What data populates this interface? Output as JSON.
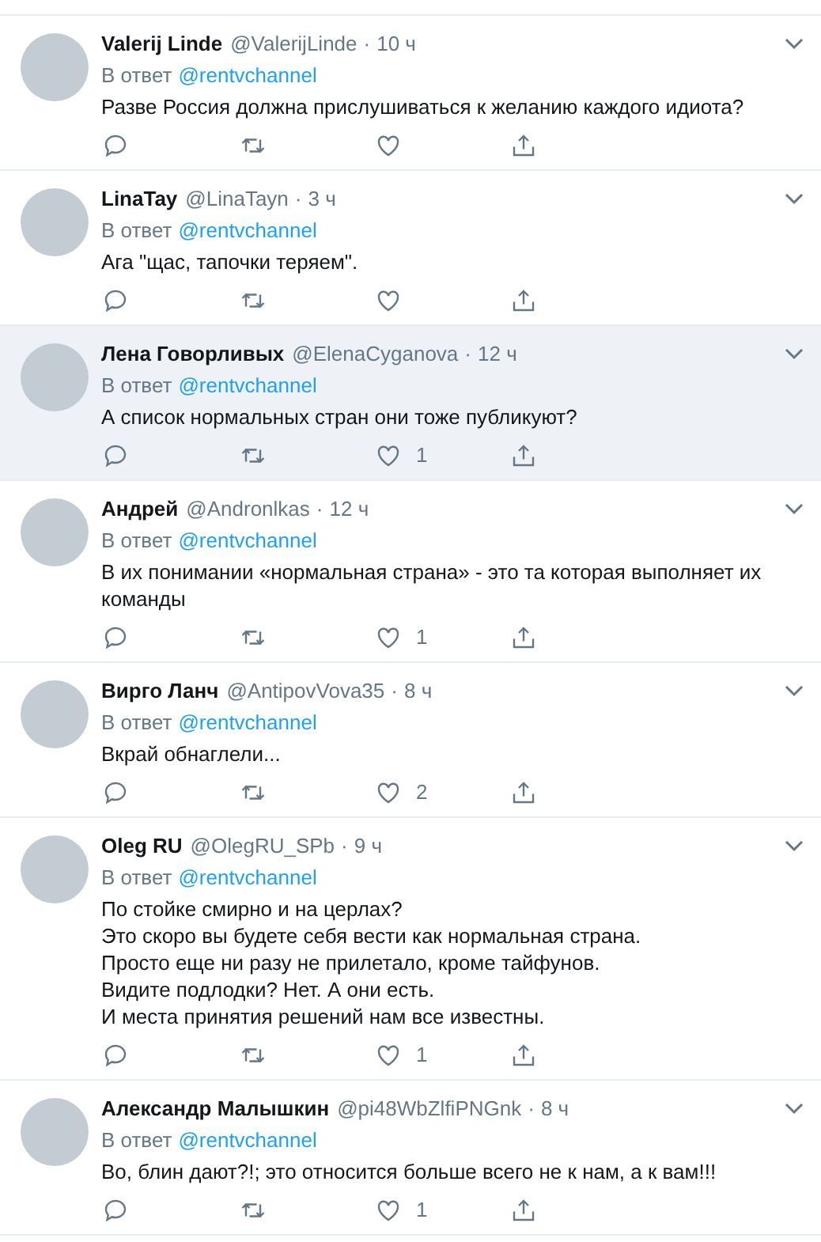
{
  "tweets": [
    {
      "name": "Valerij Linde",
      "handle": "@ValerijLinde",
      "dot": "·",
      "time": "10 ч",
      "reply_label": "В ответ",
      "reply_to": "@rentvchannel",
      "text": "Разве Россия должна прислушиваться к желанию каждого идиота?",
      "highlighted": false
    },
    {
      "name": "LinaTay",
      "handle": "@LinaTayn",
      "dot": "·",
      "time": "3 ч",
      "reply_label": "В ответ",
      "reply_to": "@rentvchannel",
      "text": "Ага \"щас, тапочки теряем\".",
      "highlighted": false
    },
    {
      "name": "Лена Говорливых",
      "handle": "@ElenaCyganova",
      "dot": "·",
      "time": "12 ч",
      "reply_label": "В ответ",
      "reply_to": "@rentvchannel",
      "text": "А список нормальных стран они тоже публикуют?",
      "likes": "1",
      "highlighted": true
    },
    {
      "name": "Андрей",
      "handle": "@Andronlkas",
      "dot": "·",
      "time": "12 ч",
      "reply_label": "В ответ",
      "reply_to": "@rentvchannel",
      "text": "В их понимании «нормальная страна» - это та которая выполняет их команды",
      "likes": "1",
      "highlighted": false
    },
    {
      "name": "Вирго Ланч",
      "handle": "@AntipovVova35",
      "dot": "·",
      "time": "8 ч",
      "reply_label": "В ответ",
      "reply_to": "@rentvchannel",
      "text": "Вкрай обнаглели...",
      "likes": "2",
      "highlighted": false
    },
    {
      "name": "Oleg RU",
      "handle": "@OlegRU_SPb",
      "dot": "·",
      "time": "9 ч",
      "reply_label": "В ответ",
      "reply_to": "@rentvchannel",
      "text": "По стойке смирно и на церлах?\nЭто скоро вы будете себя вести как нормальная страна.\nПросто еще ни разу не прилетало, кроме тайфунов.\nВидите подлодки? Нет. А они есть.\nИ места принятия решений нам все известны.",
      "likes": "1",
      "highlighted": false
    },
    {
      "name": "Александр Малышкин",
      "handle": "@pi48WbZlfiPNGnk",
      "dot": "·",
      "time": "8 ч",
      "reply_label": "В ответ",
      "reply_to": "@rentvchannel",
      "text": "Во, блин дают?!; это относится больше всего не к нам, а к вам!!!",
      "likes": "1",
      "highlighted": false
    }
  ]
}
